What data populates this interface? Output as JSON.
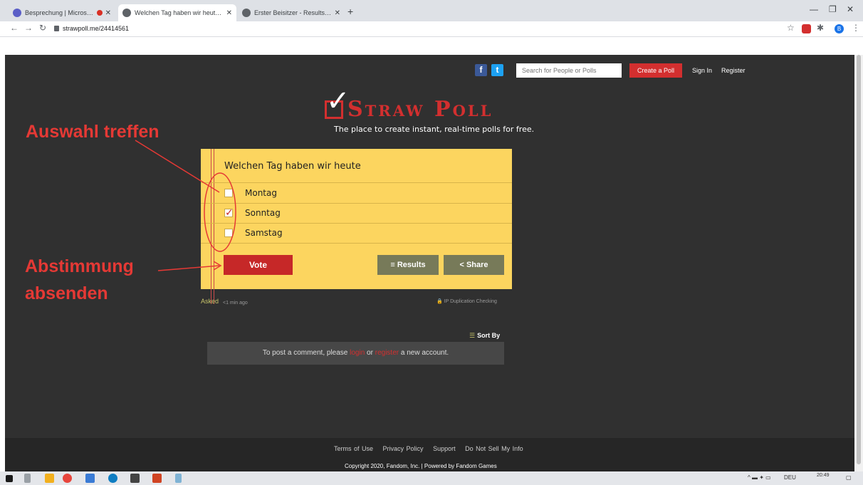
{
  "browser": {
    "tabs": [
      {
        "title": "Besprechung | Microsoft Tea",
        "active": false,
        "recording": true
      },
      {
        "title": "Welchen Tag haben wir heute - S",
        "active": true,
        "recording": false
      },
      {
        "title": "Erster Beisitzer - Results - Straw P",
        "active": false,
        "recording": false
      }
    ],
    "new_tab": "+",
    "url": "strawpoll.me/24414561",
    "profile_initial": "B",
    "window_controls": {
      "minimize": "—",
      "maximize": "❐",
      "close": "✕"
    }
  },
  "site": {
    "social": {
      "facebook": "f",
      "twitter": "t"
    },
    "search_placeholder": "Search for People or Polls",
    "create_button": "Create a Poll",
    "sign_in": "Sign In",
    "register": "Register",
    "logo_text": "Straw Poll",
    "tagline": "The place to create instant, real-time polls for free."
  },
  "poll": {
    "question": "Welchen Tag haben wir heute",
    "options": [
      {
        "label": "Montag",
        "checked": false
      },
      {
        "label": "Sonntag",
        "checked": true
      },
      {
        "label": "Samstag",
        "checked": false
      }
    ],
    "vote_button": "Vote",
    "results_button": "≡ Results",
    "share_button": "< Share",
    "asked_label": "Asked",
    "asked_time": "<1 min ago",
    "ip_check": "🔒 IP Duplication Checking"
  },
  "comments": {
    "sort_by": "Sort By",
    "prompt_before": "To post a comment, please ",
    "login": "login",
    "or": " or ",
    "register": "register",
    "prompt_after": " a new account."
  },
  "footer": {
    "links": [
      "Terms of Use",
      "Privacy Policy",
      "Support",
      "Do Not Sell My Info"
    ],
    "copyright": "Copyright 2020, Fandom, Inc. | Powered by Fandom Games"
  },
  "annotations": {
    "select": "Auswahl treffen",
    "submit_line1": "Abstimmung",
    "submit_line2": "absenden"
  },
  "taskbar": {
    "language": "DEU",
    "time": "20:49"
  },
  "colors": {
    "page_bg": "#303030",
    "card_bg": "#fcd55f",
    "brand_red": "#d32f2f",
    "olive_button": "#777a59",
    "annotation_red": "#e53935"
  }
}
